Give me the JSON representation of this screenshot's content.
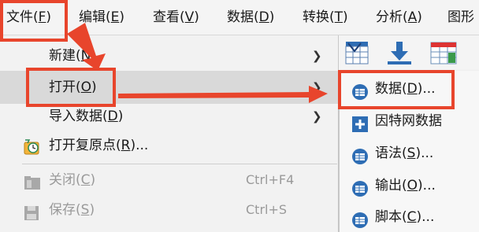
{
  "menubar": {
    "items": [
      {
        "text": "文件(",
        "key": "F",
        "tail": ")"
      },
      {
        "text": "编辑(",
        "key": "E",
        "tail": ")"
      },
      {
        "text": "查看(",
        "key": "V",
        "tail": ")"
      },
      {
        "text": "数据(",
        "key": "D",
        "tail": ")"
      },
      {
        "text": "转换(",
        "key": "T",
        "tail": ")"
      },
      {
        "text": "分析(",
        "key": "A",
        "tail": ")"
      },
      {
        "text": "图形",
        "key": "",
        "tail": ""
      }
    ]
  },
  "file_menu": {
    "items": [
      {
        "text": "新建(",
        "key": "N",
        "tail": ")",
        "shortcut": "",
        "submenu": true,
        "disabled": false
      },
      {
        "text": "打开(",
        "key": "O",
        "tail": ")",
        "shortcut": "",
        "submenu": true,
        "disabled": false
      },
      {
        "text": "导入数据(",
        "key": "D",
        "tail": ")",
        "shortcut": "",
        "submenu": true,
        "disabled": false
      },
      {
        "text": "打开复原点(",
        "key": "R",
        "tail": ")...",
        "shortcut": "",
        "submenu": false,
        "disabled": false
      },
      {
        "text": "关闭(",
        "key": "C",
        "tail": ")",
        "shortcut": "Ctrl+F4",
        "submenu": false,
        "disabled": true
      },
      {
        "text": "保存(",
        "key": "S",
        "tail": ")",
        "shortcut": "Ctrl+S",
        "submenu": false,
        "disabled": true
      }
    ]
  },
  "open_submenu": {
    "items": [
      {
        "text": "数据(",
        "key": "D",
        "tail": ")..."
      },
      {
        "text": "因特网数据",
        "key": "",
        "tail": ""
      },
      {
        "text": "语法(",
        "key": "S",
        "tail": ")..."
      },
      {
        "text": "输出(",
        "key": "O",
        "tail": ")..."
      },
      {
        "text": "脚本(",
        "key": "C",
        "tail": ")..."
      }
    ]
  },
  "colors": {
    "annotation": "#e8452c",
    "highlight": "#d9d9d9",
    "icon_blue": "#2e6db4"
  }
}
